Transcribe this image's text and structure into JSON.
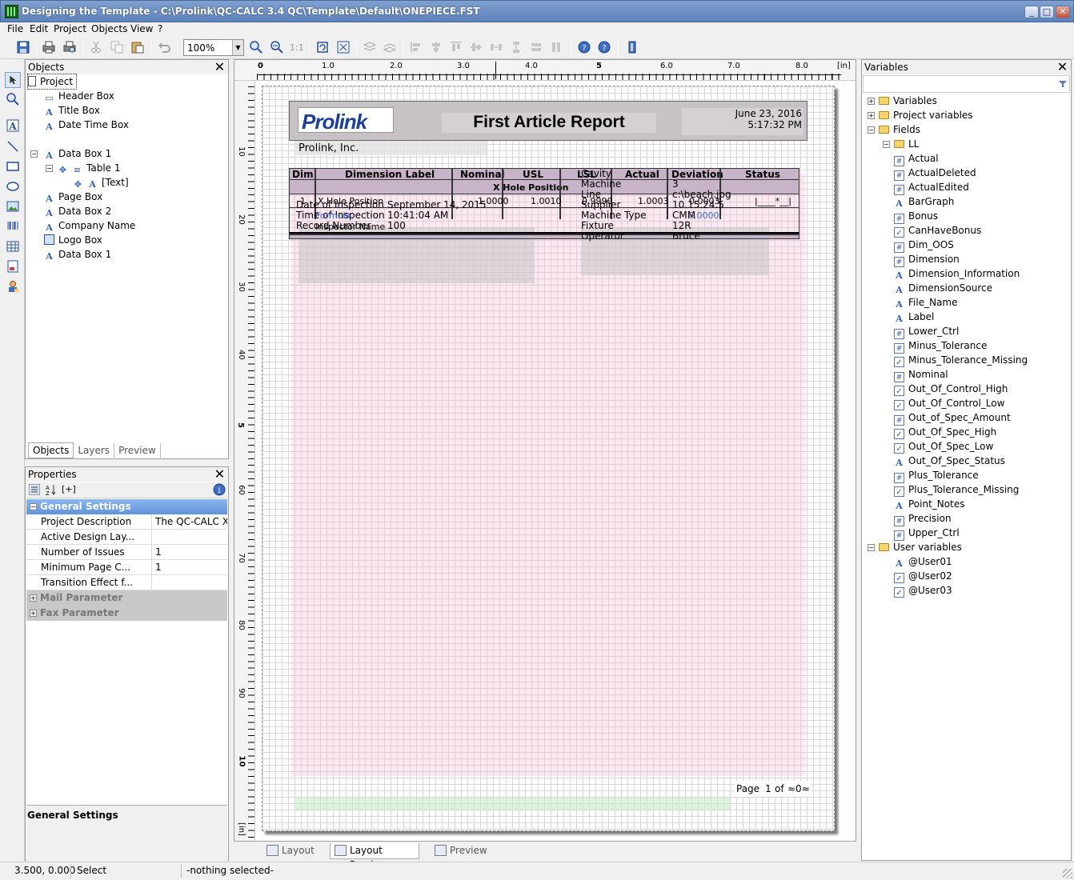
{
  "titlebar": {
    "title": "Designing the Template - C:\\Prolink\\QC-CALC 3.4 QC\\Template\\Default\\ONEPIECE.FST"
  },
  "menu": {
    "items": [
      "File",
      "Edit",
      "Project",
      "Objects",
      "View",
      "?"
    ]
  },
  "toolbar": {
    "zoom": "100%",
    "one_to_one": "1:1"
  },
  "objects_panel": {
    "title": "Objects",
    "items": [
      "Project",
      "Header Box",
      "Title Box",
      "Date Time Box",
      "Data Box 1",
      "Table 1",
      "[Text]",
      "Page Box",
      "Data Box 2",
      "Company Name",
      "Logo Box",
      "Data Box 1"
    ],
    "tabs": [
      "Objects",
      "Layers",
      "Preview"
    ]
  },
  "properties_panel": {
    "title": "Properties",
    "sort_label": "[+]",
    "group_general": "General Settings",
    "rows": [
      {
        "k": "Project Description",
        "v": "The QC-CALC Xbar ..."
      },
      {
        "k": "Active Design Lay...",
        "v": ""
      },
      {
        "k": "Number of Issues",
        "v": "1"
      },
      {
        "k": "Minimum Page C...",
        "v": "1"
      },
      {
        "k": "Transition Effect f...",
        "v": ""
      }
    ],
    "group_mail": "Mail Parameter",
    "group_fax": "Fax Parameter",
    "description_title": "General Settings"
  },
  "ruler": {
    "unit": "[in]",
    "top_labels": [
      "0",
      "1.0",
      "2.0",
      "3.0",
      "4.0",
      "5",
      "6.0",
      "7.0",
      "8.0"
    ],
    "left_labels": [
      "10",
      "20",
      "30",
      "40",
      "5",
      "60",
      "70",
      "80",
      "90",
      "10",
      "[in]"
    ]
  },
  "report": {
    "logo": "Prolink",
    "title": "First Article Report",
    "date": "June 23, 2016",
    "time": "5:17:32 PM",
    "company": "Prolink, Inc.",
    "table_headers": [
      "Dim",
      "Dimension Label",
      "Nominal",
      "USL",
      "LSL",
      "Actual",
      "Deviation",
      "Status"
    ],
    "group_row": "X Hole Position",
    "row": {
      "dim": "1",
      "label": "X Hole Position",
      "nominal": "1.0000",
      "usl": "1.0010",
      "lsl": "0.9990",
      "actual": "1.0003",
      "deviation": "0.0003",
      "status": "|____*__|"
    },
    "left_info": [
      {
        "k": "Date of Inspection",
        "v": "September 14, 2015"
      },
      {
        "k": "Time of Inspection",
        "v": "10:41:04 AM"
      },
      {
        "k": "Record Number",
        "v": "100"
      }
    ],
    "overlay_text": [
      "Formula",
      "Inspector Name"
    ],
    "right_info": [
      {
        "k": "Cavity",
        "v": ""
      },
      {
        "k": "Machine",
        "v": "3"
      },
      {
        "k": "Line",
        "v": "c:\\beach.jpg"
      },
      {
        "k": "Supplier",
        "v": "10.15.24.5"
      },
      {
        "k": "Machine Type",
        "v": "CMM"
      },
      {
        "k": "Fixture",
        "v": "12R"
      },
      {
        "k": "Operator",
        "v": "Bruce"
      }
    ],
    "overlay_value": "0.0000",
    "footer_page": "Page",
    "footer_num": "1",
    "footer_of": "of",
    "footer_total": "≈0≈"
  },
  "variables_panel": {
    "title": "Variables",
    "items": [
      {
        "label": "Variables",
        "icon": "folder",
        "indent": 0
      },
      {
        "label": "Project variables",
        "icon": "folder",
        "indent": 0
      },
      {
        "label": "Fields",
        "icon": "folder",
        "indent": 0
      },
      {
        "label": "LL",
        "icon": "folder",
        "indent": 1
      },
      {
        "label": "Actual",
        "icon": "hash",
        "indent": 1
      },
      {
        "label": "ActualDeleted",
        "icon": "hash",
        "indent": 1
      },
      {
        "label": "ActualEdited",
        "icon": "hash",
        "indent": 1
      },
      {
        "label": "BarGraph",
        "icon": "text",
        "indent": 1
      },
      {
        "label": "Bonus",
        "icon": "hash",
        "indent": 1
      },
      {
        "label": "CanHaveBonus",
        "icon": "check",
        "indent": 1
      },
      {
        "label": "Dim_OOS",
        "icon": "hash",
        "indent": 1
      },
      {
        "label": "Dimension",
        "icon": "hash",
        "indent": 1
      },
      {
        "label": "Dimension_Information",
        "icon": "text",
        "indent": 1
      },
      {
        "label": "DimensionSource",
        "icon": "text",
        "indent": 1
      },
      {
        "label": "File_Name",
        "icon": "text",
        "indent": 1
      },
      {
        "label": "Label",
        "icon": "text",
        "indent": 1
      },
      {
        "label": "Lower_Ctrl",
        "icon": "hash",
        "indent": 1
      },
      {
        "label": "Minus_Tolerance",
        "icon": "hash",
        "indent": 1
      },
      {
        "label": "Minus_Tolerance_Missing",
        "icon": "check",
        "indent": 1
      },
      {
        "label": "Nominal",
        "icon": "hash",
        "indent": 1
      },
      {
        "label": "Out_Of_Control_High",
        "icon": "check",
        "indent": 1
      },
      {
        "label": "Out_Of_Control_Low",
        "icon": "check",
        "indent": 1
      },
      {
        "label": "Out_of_Spec_Amount",
        "icon": "hash",
        "indent": 1
      },
      {
        "label": "Out_Of_Spec_High",
        "icon": "check",
        "indent": 1
      },
      {
        "label": "Out_Of_Spec_Low",
        "icon": "check",
        "indent": 1
      },
      {
        "label": "Out_Of_Spec_Status",
        "icon": "text",
        "indent": 1
      },
      {
        "label": "Plus_Tolerance",
        "icon": "hash",
        "indent": 1
      },
      {
        "label": "Plus_Tolerance_Missing",
        "icon": "check",
        "indent": 1
      },
      {
        "label": "Point_Notes",
        "icon": "text",
        "indent": 1
      },
      {
        "label": "Precision",
        "icon": "hash",
        "indent": 1
      },
      {
        "label": "Upper_Ctrl",
        "icon": "hash",
        "indent": 1
      },
      {
        "label": "User variables",
        "icon": "folder",
        "indent": 0
      },
      {
        "label": "@User01",
        "icon": "text",
        "indent": 1
      },
      {
        "label": "@User02",
        "icon": "check",
        "indent": 1
      },
      {
        "label": "@User03",
        "icon": "check",
        "indent": 1
      }
    ]
  },
  "bottom_tabs": [
    "Layout",
    "Layout Preview",
    "Preview"
  ],
  "status": {
    "coords": "3.500, 0.000",
    "mode": "Select",
    "selection": "-nothing selected-"
  },
  "colors": {
    "accent": "#5f93dc",
    "title_grad": "#6f92c5",
    "logo_blue": "#1b3f9a"
  }
}
